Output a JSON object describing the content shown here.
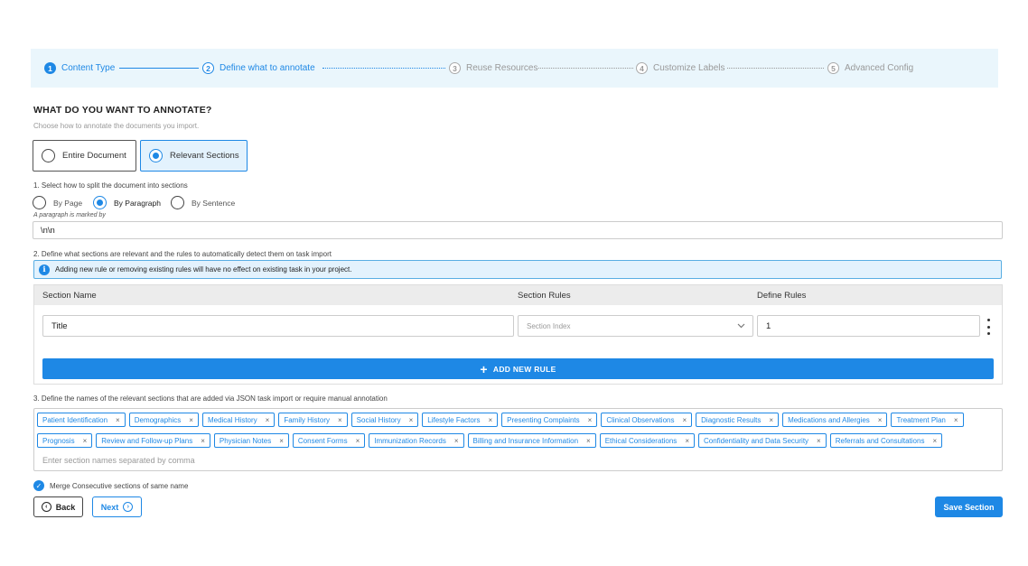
{
  "stepper": {
    "steps": [
      {
        "num": "1",
        "label": "Content Type"
      },
      {
        "num": "2",
        "label": "Define what to annotate"
      },
      {
        "num": "3",
        "label": "Reuse Resources"
      },
      {
        "num": "4",
        "label": "Customize Labels"
      },
      {
        "num": "5",
        "label": "Advanced Config"
      }
    ],
    "current_step": 2
  },
  "header": {
    "title": "WHAT DO YOU WANT TO ANNOTATE?",
    "subtitle": "Choose how to annotate the documents you import."
  },
  "mode": {
    "options": [
      "Entire Document",
      "Relevant Sections"
    ],
    "selected": "Relevant Sections"
  },
  "split": {
    "question": "1. Select how to split the document into sections",
    "options": [
      "By Page",
      "By Paragraph",
      "By Sentence"
    ],
    "selected": "By Paragraph",
    "marker_label": "A paragraph is marked by",
    "marker_value": "\\n\\n"
  },
  "rules": {
    "question": "2. Define what sections are relevant and the rules to automatically detect them on task import",
    "info": "Adding new rule or removing existing rules will have no effect on existing task in your project.",
    "columns": [
      "Section Name",
      "Section Rules",
      "Define Rules"
    ],
    "rows": [
      {
        "name": "Title",
        "rule_placeholder": "Section Index",
        "value": "1"
      }
    ],
    "add_label": "ADD NEW RULE"
  },
  "sections": {
    "question": "3. Define the names of the relevant sections that are added via JSON task import or require manual annotation",
    "tags_row1": [
      "Patient Identification",
      "Demographics",
      "Medical History",
      "Family History",
      "Social History",
      "Lifestyle Factors",
      "Presenting Complaints",
      "Clinical Observations",
      "Diagnostic Results",
      "Medications and Allergies",
      "Treatment Plan"
    ],
    "tags_row2": [
      "Prognosis",
      "Review and Follow-up Plans",
      "Physician Notes",
      "Consent Forms",
      "Immunization Records",
      "Billing and Insurance Information",
      "Ethical Considerations",
      "Confidentiality and Data Security",
      "Referrals and Consultations"
    ],
    "remove_glyph": "×",
    "placeholder": "Enter section names separated by comma"
  },
  "merge": {
    "label": "Merge Consecutive sections of same name",
    "checked": true
  },
  "footer": {
    "back_label": "Back",
    "next_label": "Next",
    "save_label": "Save Section"
  },
  "colors": {
    "accent": "#1e88e5",
    "stepper_bg": "#eaf6fc"
  }
}
